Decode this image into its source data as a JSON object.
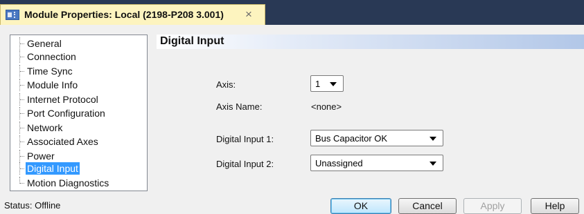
{
  "window": {
    "tab_title": "Module Properties: Local (2198-P208 3.001)",
    "close_glyph": "×",
    "icon": "module-icon",
    "titlebar_color": "#293955",
    "tab_color": "#fdf4bf"
  },
  "tree": {
    "items": [
      {
        "label": "General"
      },
      {
        "label": "Connection"
      },
      {
        "label": "Time Sync"
      },
      {
        "label": "Module Info"
      },
      {
        "label": "Internet Protocol"
      },
      {
        "label": "Port Configuration"
      },
      {
        "label": "Network"
      },
      {
        "label": "Associated Axes"
      },
      {
        "label": "Power"
      },
      {
        "label": "Digital Input",
        "selected": true
      },
      {
        "label": "Motion Diagnostics"
      }
    ],
    "selection_color": "#3399ff"
  },
  "page": {
    "title": "Digital Input",
    "axis_label": "Axis:",
    "axis_value": "1",
    "axis_name_label": "Axis Name:",
    "axis_name_value": "<none>",
    "di1_label": "Digital Input 1:",
    "di1_value": "Bus Capacitor OK",
    "di2_label": "Digital Input 2:",
    "di2_value": "Unassigned"
  },
  "footer": {
    "status": "Status:  Offline",
    "ok_label": "OK",
    "cancel_label": "Cancel",
    "apply_label": "Apply",
    "help_label": "Help"
  }
}
